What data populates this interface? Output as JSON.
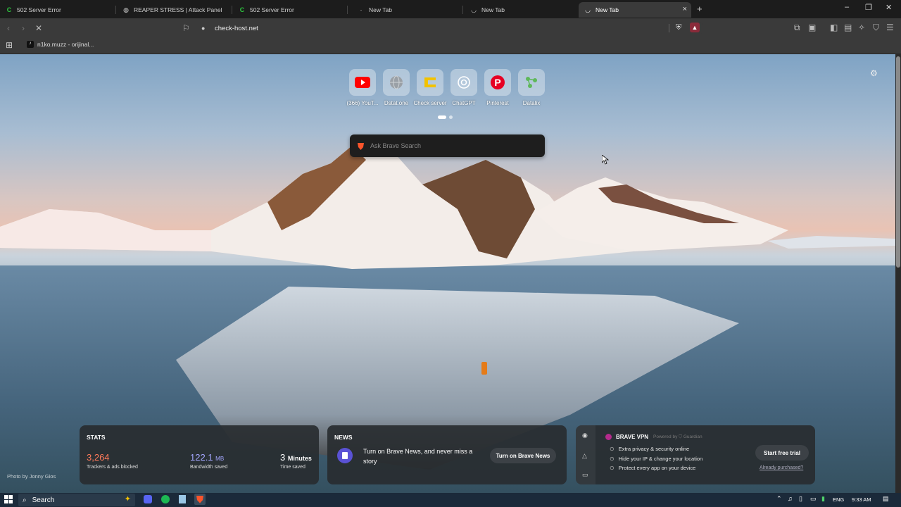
{
  "tabs": [
    {
      "title": "502 Server Error",
      "icon": "c-logo-icon",
      "active": false
    },
    {
      "title": "REAPER STRESS | Attack Panel",
      "icon": "globe-icon",
      "active": false
    },
    {
      "title": "502 Server Error",
      "icon": "c-logo-icon",
      "active": false
    },
    {
      "title": "New Tab",
      "icon": "loading-icon",
      "active": false
    },
    {
      "title": "New Tab",
      "icon": "loading-icon",
      "active": false
    },
    {
      "title": "New Tab",
      "icon": "loading-icon",
      "active": true
    }
  ],
  "toolbar": {
    "url": "check-host.net"
  },
  "bookmarks": [
    {
      "label": "n1ko.muzz - orijinal..."
    }
  ],
  "shortcuts": [
    {
      "label": "(366) YouT...",
      "icon": "youtube-icon",
      "color": "#ff0000"
    },
    {
      "label": "Dstat.one",
      "icon": "globe-icon",
      "color": "#9aa0a6"
    },
    {
      "label": "Check server",
      "icon": "c-logo-icon",
      "color": "#f2c200"
    },
    {
      "label": "ChatGPT",
      "icon": "chatgpt-icon",
      "color": "#ffffff"
    },
    {
      "label": "Pinterest",
      "icon": "pinterest-icon",
      "color": "#e60023"
    },
    {
      "label": "Datalix",
      "icon": "datalix-icon",
      "color": "#5fb85a"
    }
  ],
  "search": {
    "placeholder": "Ask Brave Search"
  },
  "stats": {
    "title": "STATS",
    "trackers_value": "3,264",
    "trackers_label": "Trackers & ads blocked",
    "bandwidth_value": "122.1",
    "bandwidth_unit": "MB",
    "bandwidth_label": "Bandwidth saved",
    "time_value": "3",
    "time_unit": "Minutes",
    "time_label": "Time saved"
  },
  "news": {
    "title": "NEWS",
    "text": "Turn on Brave News, and never miss a story",
    "button": "Turn on Brave News"
  },
  "vpn": {
    "title": "BRAVE VPN",
    "powered": "Powered by",
    "partner": "Guardian",
    "features": [
      "Extra privacy & security online",
      "Hide your IP & change your location",
      "Protect every app on your device"
    ],
    "button": "Start free trial",
    "link": "Already purchased?"
  },
  "photo_credit": "Photo by Jonny Gios",
  "taskbar": {
    "search": "Search",
    "lang": "ENG",
    "time": "9:33 AM"
  },
  "colors": {
    "trackers": "#ff7a5a",
    "bandwidth": "#a4a7ff",
    "accent": "#fb542b"
  }
}
